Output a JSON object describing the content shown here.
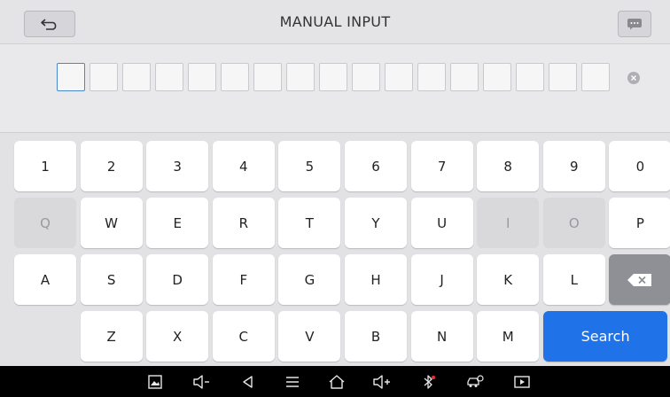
{
  "header": {
    "title": "MANUAL INPUT",
    "back_icon": "return-icon",
    "message_icon": "message-icon"
  },
  "input": {
    "box_count": 17,
    "clear_icon": "clear-icon"
  },
  "keyboard": {
    "row1": [
      "1",
      "2",
      "3",
      "4",
      "5",
      "6",
      "7",
      "8",
      "9",
      "0"
    ],
    "row2": [
      {
        "label": "Q",
        "disabled": true
      },
      {
        "label": "W",
        "disabled": false
      },
      {
        "label": "E",
        "disabled": false
      },
      {
        "label": "R",
        "disabled": false
      },
      {
        "label": "T",
        "disabled": false
      },
      {
        "label": "Y",
        "disabled": false
      },
      {
        "label": "U",
        "disabled": false
      },
      {
        "label": "I",
        "disabled": true
      },
      {
        "label": "O",
        "disabled": true
      },
      {
        "label": "P",
        "disabled": false
      }
    ],
    "row3": [
      "A",
      "S",
      "D",
      "F",
      "G",
      "H",
      "J",
      "K",
      "L"
    ],
    "row4": [
      "Z",
      "X",
      "C",
      "V",
      "B",
      "N",
      "M"
    ],
    "backspace_icon": "backspace-icon",
    "search_label": "Search"
  },
  "system_bar": {
    "icons": [
      "screenshot-icon",
      "volume-down-icon",
      "back-icon",
      "menu-icon",
      "home-icon",
      "volume-up-icon",
      "bluetooth-icon",
      "vci-car-icon",
      "screen-record-icon"
    ]
  },
  "colors": {
    "accent": "#1f72e8",
    "backspace": "#8e9096",
    "disabled_key": "#d9d9dc"
  }
}
